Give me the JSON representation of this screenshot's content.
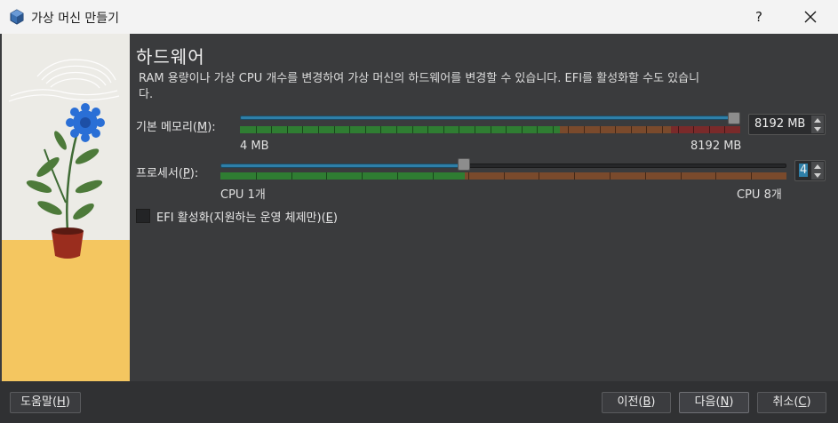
{
  "window": {
    "title": "가상 머신 만들기",
    "help_label": "?"
  },
  "page": {
    "title": "하드웨어",
    "description": "RAM 용량이나 가상 CPU 개수를 변경하여 가상 머신의 하드웨어를 변경할 수 있습니다. EFI를 활성화할 수도 있습니다."
  },
  "memory": {
    "label": "기본 메모리(M):",
    "label_prefix": "기본 메모리(",
    "mnemonic": "M",
    "label_suffix": "):",
    "value": "8192 MB",
    "min_label": "4 MB",
    "max_label": "8192 MB",
    "level_fraction": 1.0
  },
  "processor": {
    "label_prefix": "프로세서(",
    "mnemonic": "P",
    "label_suffix": "):",
    "value": "4",
    "min_label": "CPU 1개",
    "max_label": "CPU 8개",
    "level": 4,
    "max": 8
  },
  "efi": {
    "label_prefix": "EFI 활성화(지원하는 운영 체제만)(",
    "mnemonic": "E",
    "label_suffix": ")",
    "checked": false
  },
  "buttons": {
    "help_prefix": "도움말(",
    "help_mnemonic": "H",
    "back_prefix": "이전(",
    "back_mnemonic": "B",
    "next_prefix": "다음(",
    "next_mnemonic": "N",
    "cancel_prefix": "취소(",
    "cancel_mnemonic": "C",
    "suffix": ")"
  },
  "colors": {
    "accent": "#2e7fa8",
    "zone_green": "#2f7d32",
    "zone_orange": "#7a4a2c",
    "zone_red": "#7a2a2a"
  }
}
